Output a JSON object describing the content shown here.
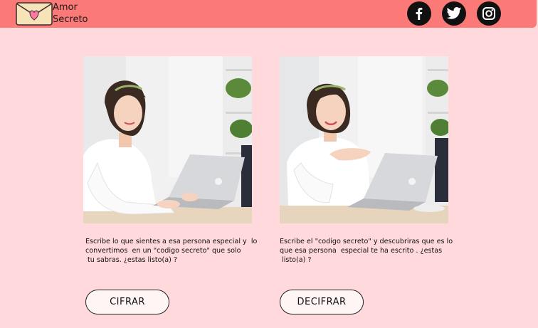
{
  "brand": {
    "line1": "Amor",
    "line2": "Secreto",
    "logo_icon": "heart-envelope-icon"
  },
  "social": [
    {
      "name": "facebook-icon",
      "glyph": "f"
    },
    {
      "name": "twitter-icon",
      "glyph": ""
    },
    {
      "name": "instagram-icon",
      "glyph": ""
    }
  ],
  "cards": [
    {
      "description": "Escribe lo que sientes a esa persona especial y  lo\nconvertimos  en un \"codigo secreto\" que solo\n tu sabras. ¿estas listo(a) ?",
      "button_label": "CIFRAR"
    },
    {
      "description": "Escribe el \"codigo secreto\" y descubriras que es lo\nque esa persona  especial te ha escrito . ¿estas\n listo(a) ?",
      "button_label": "DECIFRAR"
    }
  ],
  "colors": {
    "header": "#fb7a78",
    "background": "#ffd9dc",
    "envelope": "#f6e3b8",
    "heart": "#ff7aa0"
  }
}
